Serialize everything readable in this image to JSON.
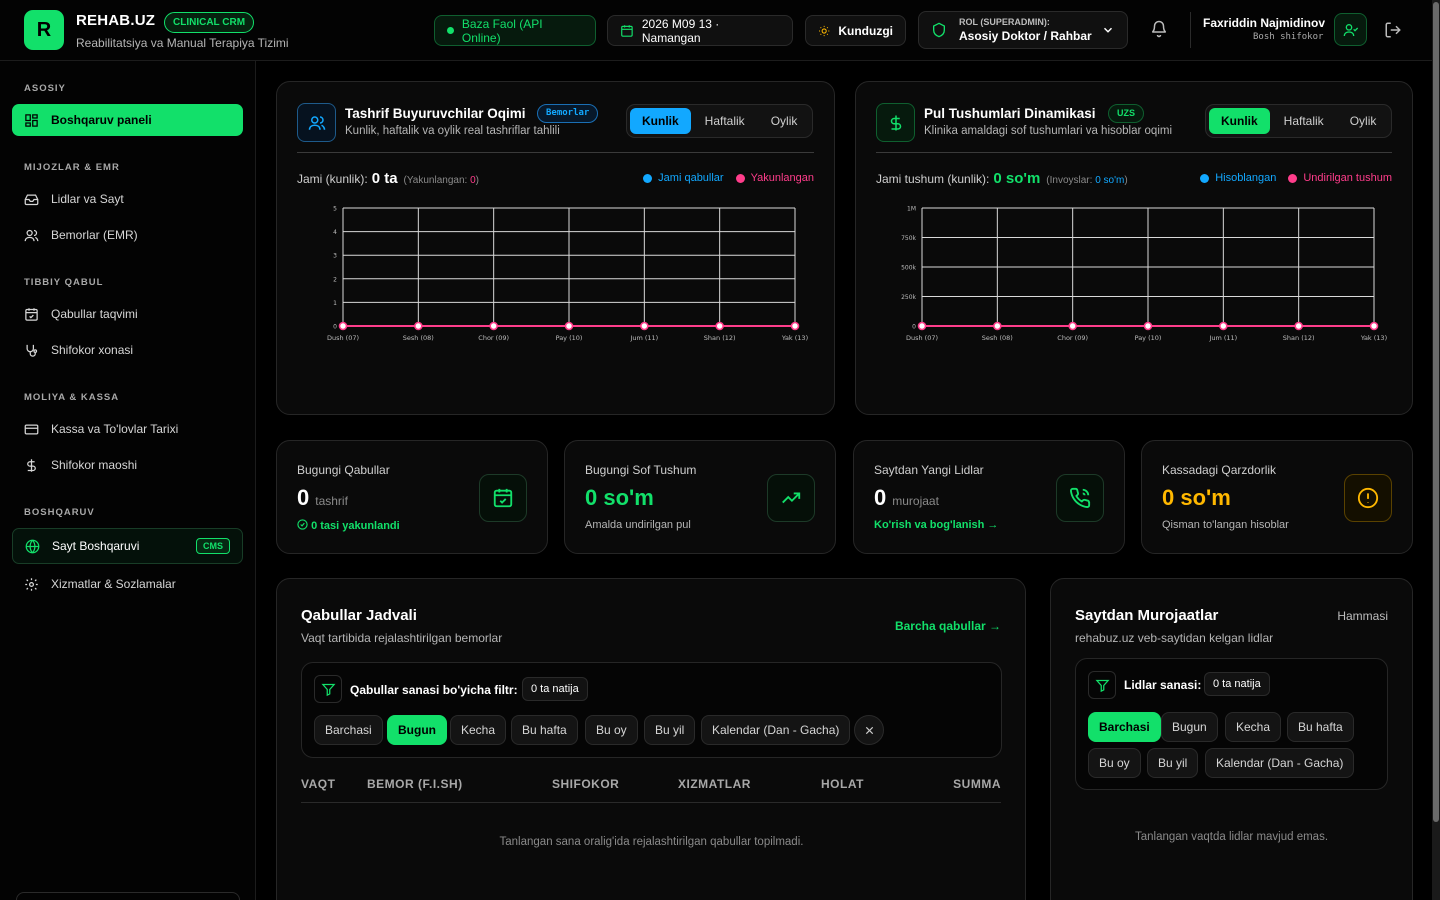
{
  "header": {
    "logo_letter": "R",
    "brand": "REHAB.UZ",
    "brand_badge": "CLINICAL CRM",
    "subtitle": "Reabilitatsiya va Manual Terapiya Tizimi",
    "api_status": "Baza Faol (API Online)",
    "date_location": "2026 M09 13 · Namangan",
    "theme_mode": "Kunduzgi",
    "role_label": "ROL (SUPERADMIN):",
    "role_value": "Asosiy Doktor / Rahbar",
    "user_name": "Faxriddin Najmidinov",
    "user_role": "Bosh shifokor"
  },
  "sidebar": {
    "sections": [
      {
        "title": "ASOSIY",
        "items": [
          {
            "label": "Boshqaruv paneli",
            "icon": "dashboard-icon",
            "active": true
          }
        ]
      },
      {
        "title": "MIJOZLAR & EMR",
        "items": [
          {
            "label": "Lidlar va Sayt",
            "icon": "inbox-icon"
          },
          {
            "label": "Bemorlar (EMR)",
            "icon": "users-icon"
          }
        ]
      },
      {
        "title": "TIBBIY QABUL",
        "items": [
          {
            "label": "Qabullar taqvimi",
            "icon": "calendar-icon"
          },
          {
            "label": "Shifokor xonasi",
            "icon": "stethoscope-icon"
          }
        ]
      },
      {
        "title": "MOLIYA & KASSA",
        "items": [
          {
            "label": "Kassa va To'lovlar Tarixi",
            "icon": "credit-card-icon"
          },
          {
            "label": "Shifokor maoshi",
            "icon": "dollar-icon"
          }
        ]
      },
      {
        "title": "BOSHQARUV",
        "items": [
          {
            "label": "Sayt Boshqaruvi",
            "icon": "globe-icon",
            "tag": "CMS"
          },
          {
            "label": "Xizmatlar & Sozlamalar",
            "icon": "gear-icon"
          }
        ]
      }
    ]
  },
  "visitors_card": {
    "title": "Tashrif Buyuruvchilar Oqimi",
    "badge": "Bemorlar",
    "subtitle": "Kunlik, haftalik va oylik real tashriflar tahlili",
    "tabs": [
      "Kunlik",
      "Haftalik",
      "Oylik"
    ],
    "active_tab": "Kunlik",
    "stat_label": "Jami (kunlik):",
    "stat_value": "0 ta",
    "stat_note_label": "(Yakunlangan:",
    "stat_note_value": "0",
    "stat_note_close": ")",
    "legend": [
      {
        "name": "Jami qabullar",
        "color": "#12a8ff"
      },
      {
        "name": "Yakunlangan",
        "color": "#ff3d8b"
      }
    ]
  },
  "income_card": {
    "title": "Pul Tushumlari Dinamikasi",
    "badge": "UZS",
    "subtitle": "Klinika amaldagi sof tushumlari va hisoblar oqimi",
    "tabs": [
      "Kunlik",
      "Haftalik",
      "Oylik"
    ],
    "active_tab": "Kunlik",
    "stat_label": "Jami tushum (kunlik):",
    "stat_value": "0 so'm",
    "stat_note_label": "(Invoyslar:",
    "stat_note_value": "0 so'm",
    "stat_note_close": ")",
    "legend": [
      {
        "name": "Hisoblangan",
        "color": "#12a8ff"
      },
      {
        "name": "Undirilgan tushum",
        "color": "#ff3d8b"
      }
    ]
  },
  "chart_data": [
    {
      "type": "line",
      "categories": [
        "Dush (07)",
        "Sesh (08)",
        "Chor (09)",
        "Pay (10)",
        "Jum (11)",
        "Shan (12)",
        "Yak (13)"
      ],
      "series": [
        {
          "name": "Jami qabullar",
          "values": [
            0,
            0,
            0,
            0,
            0,
            0,
            0
          ],
          "color": "#12a8ff"
        },
        {
          "name": "Yakunlangan",
          "values": [
            0,
            0,
            0,
            0,
            0,
            0,
            0
          ],
          "color": "#ff3d8b"
        }
      ],
      "ylim": [
        0,
        5
      ],
      "yticks": [
        "0",
        "1",
        "2",
        "3",
        "4",
        "5"
      ],
      "grid": true
    },
    {
      "type": "line",
      "categories": [
        "Dush (07)",
        "Sesh (08)",
        "Chor (09)",
        "Pay (10)",
        "Jum (11)",
        "Shan (12)",
        "Yak (13)"
      ],
      "series": [
        {
          "name": "Hisoblangan",
          "values": [
            0,
            0,
            0,
            0,
            0,
            0,
            0
          ],
          "color": "#12a8ff"
        },
        {
          "name": "Undirilgan tushum",
          "values": [
            0,
            0,
            0,
            0,
            0,
            0,
            0
          ],
          "color": "#ff3d8b"
        }
      ],
      "ylim": [
        0,
        1000000
      ],
      "yticks": [
        "0",
        "250k",
        "500k",
        "750k",
        "1M"
      ],
      "grid": true
    }
  ],
  "kpis": [
    {
      "title": "Bugungi Qabullar",
      "value": "0",
      "unit": "tashrif",
      "foot": "0 tasi yakunlandi",
      "icon": "calendar-check-icon"
    },
    {
      "title": "Bugungi Sof Tushum",
      "value": "0 so'm",
      "unit": "",
      "foot": "Amalda undirilgan pul",
      "icon": "trending-up-icon"
    },
    {
      "title": "Saytdan Yangi Lidlar",
      "value": "0",
      "unit": "murojaat",
      "foot": "Ko'rish va bog'lanish →",
      "icon": "phone-icon"
    },
    {
      "title": "Kassadagi Qarzdorlik",
      "value": "0 so'm",
      "unit": "",
      "foot": "Qisman to'langan hisoblar",
      "icon": "alert-circle-icon"
    }
  ],
  "appointments": {
    "title": "Qabullar Jadvali",
    "subtitle": "Vaqt tartibida rejalashtirilgan bemorlar",
    "link": "Barcha qabullar →",
    "filter_label": "Qabullar sanasi bo'yicha filtr:",
    "filter_count": "0 ta natija",
    "chips": [
      "Barchasi",
      "Bugun",
      "Kecha",
      "Bu hafta",
      "Bu oy",
      "Bu yil",
      "Kalendar (Dan - Gacha)"
    ],
    "active_chip": "Bugun",
    "columns": [
      "VAQT",
      "BEMOR (F.I.SH)",
      "SHIFOKOR",
      "XIZMATLAR",
      "HOLAT",
      "SUMMA"
    ],
    "empty": "Tanlangan sana oralig'ida rejalashtirilgan qabullar topilmadi."
  },
  "leads": {
    "title": "Saytdan Murojaatlar",
    "subtitle": "rehabuz.uz veb-saytidan kelgan lidlar",
    "link": "Hammasi",
    "filter_label": "Lidlar sanasi:",
    "filter_count": "0 ta natija",
    "chips": [
      "Barchasi",
      "Bugun",
      "Kecha",
      "Bu hafta",
      "Bu oy",
      "Bu yil",
      "Kalendar (Dan - Gacha)"
    ],
    "active_chip": "Barchasi",
    "empty": "Tanlangan vaqtda lidlar mavjud emas."
  }
}
